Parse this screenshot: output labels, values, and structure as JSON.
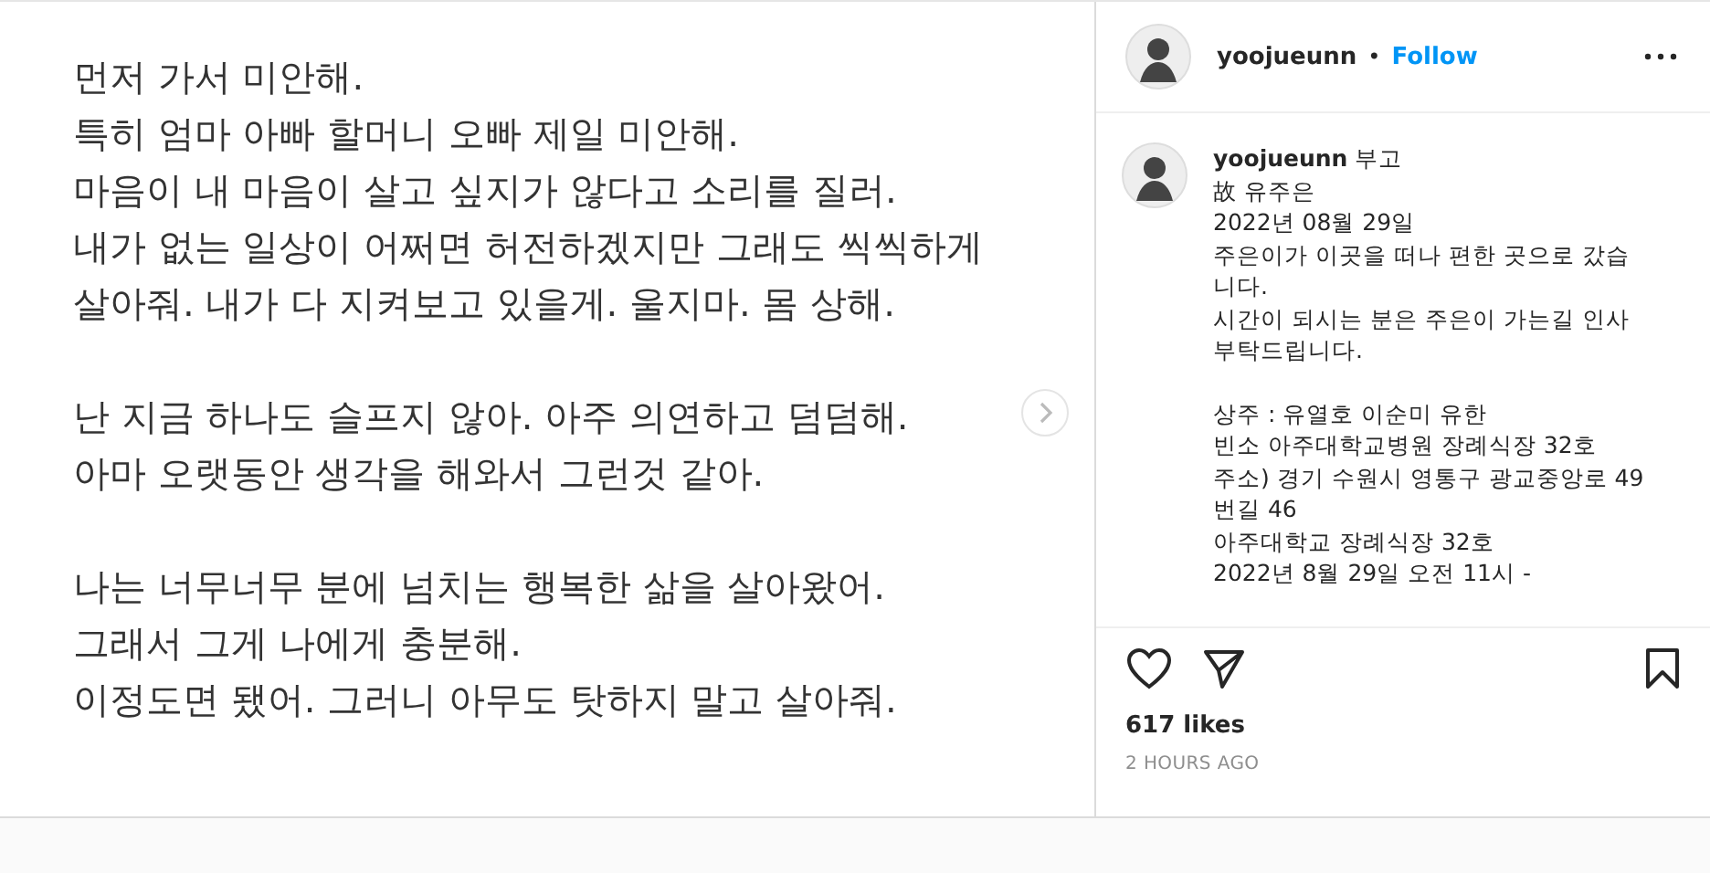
{
  "post_image": {
    "paragraphs": [
      [
        "먼저 가서 미안해.",
        "특히 엄마 아빠 할머니 오빠 제일 미안해.",
        "마음이 내 마음이 살고 싶지가 않다고 소리를 질러.",
        "내가 없는 일상이 어쩌면 허전하겠지만 그래도 씩씩하게",
        "살아줘. 내가 다 지켜보고 있을게. 울지마. 몸 상해."
      ],
      [
        "난 지금 하나도 슬프지 않아. 아주 의연하고 덤덤해.",
        "아마 오랫동안 생각을 해와서 그런것 같아."
      ],
      [
        "나는 너무너무 분에 넘치는 행복한 삶을 살아왔어.",
        "그래서 그게 나에게 충분해.",
        "이정도면 됐어. 그러니 아무도 탓하지 말고 살아줘."
      ]
    ]
  },
  "header": {
    "username": "yoojueunn",
    "separator": "•",
    "follow": "Follow"
  },
  "caption": {
    "paragraphs": [
      [
        "**yoojueunn** 부고",
        "故 유주은",
        "2022년 08월 29일",
        "주은이가 이곳을 떠나 편한 곳으로 갔습니다.",
        "시간이 되시는 분은 주은이 가는길 인사부탁드립니다."
      ],
      [
        "상주 : 유열호 이순미 유한",
        "빈소 아주대학교병원 장례식장 32호",
        "주소) 경기 수원시 영통구 광교중앙로 49번길 46",
        "아주대학교 장례식장 32호",
        "2022년 8월 29일 오전 11시 -"
      ]
    ]
  },
  "actions": {
    "liked": false,
    "saved": false
  },
  "likes": "617 likes",
  "time": "2 HOURS AGO"
}
